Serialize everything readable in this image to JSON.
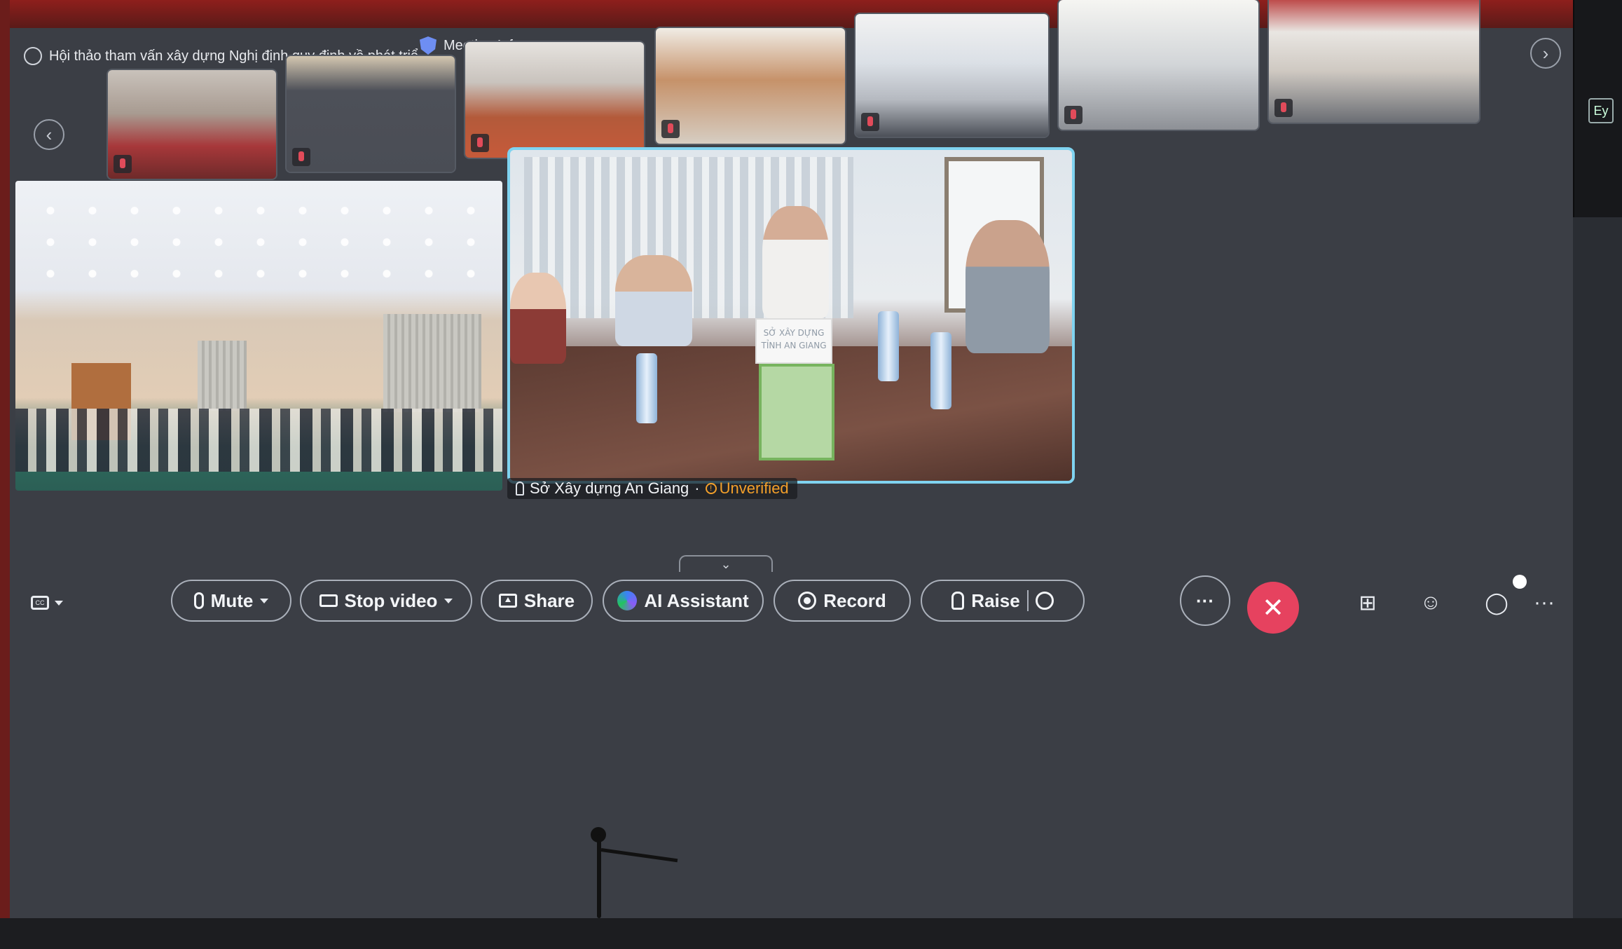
{
  "meeting": {
    "title": "Hội thảo tham vấn xây dựng Nghị định quy định về phát triể...",
    "info_label": "Meeting Info"
  },
  "thumbnails": {
    "count": 7,
    "prev_icon": "chevron-left-icon",
    "next_icon": "chevron-right-icon"
  },
  "main": {
    "active_speaker": {
      "name": "Sở Xây dựng An Giang",
      "status": "Unverified",
      "nameplate": "SỞ XÂY DỰNG TỈNH AN GIANG"
    }
  },
  "toolbar": {
    "mute_label": "Mute",
    "stop_video_label": "Stop video",
    "share_label": "Share",
    "ai_label": "AI Assistant",
    "record_label": "Record",
    "raise_label": "Raise",
    "more_label": "···",
    "leave_icon": "✕",
    "right_more_label": "···",
    "collapse_icon": "⌄"
  },
  "colors": {
    "leave_button": "#e6425f",
    "active_speaker_border": "#7fd3f0",
    "unverified": "#f4a02a"
  },
  "device": {
    "side_label": "Ey"
  }
}
